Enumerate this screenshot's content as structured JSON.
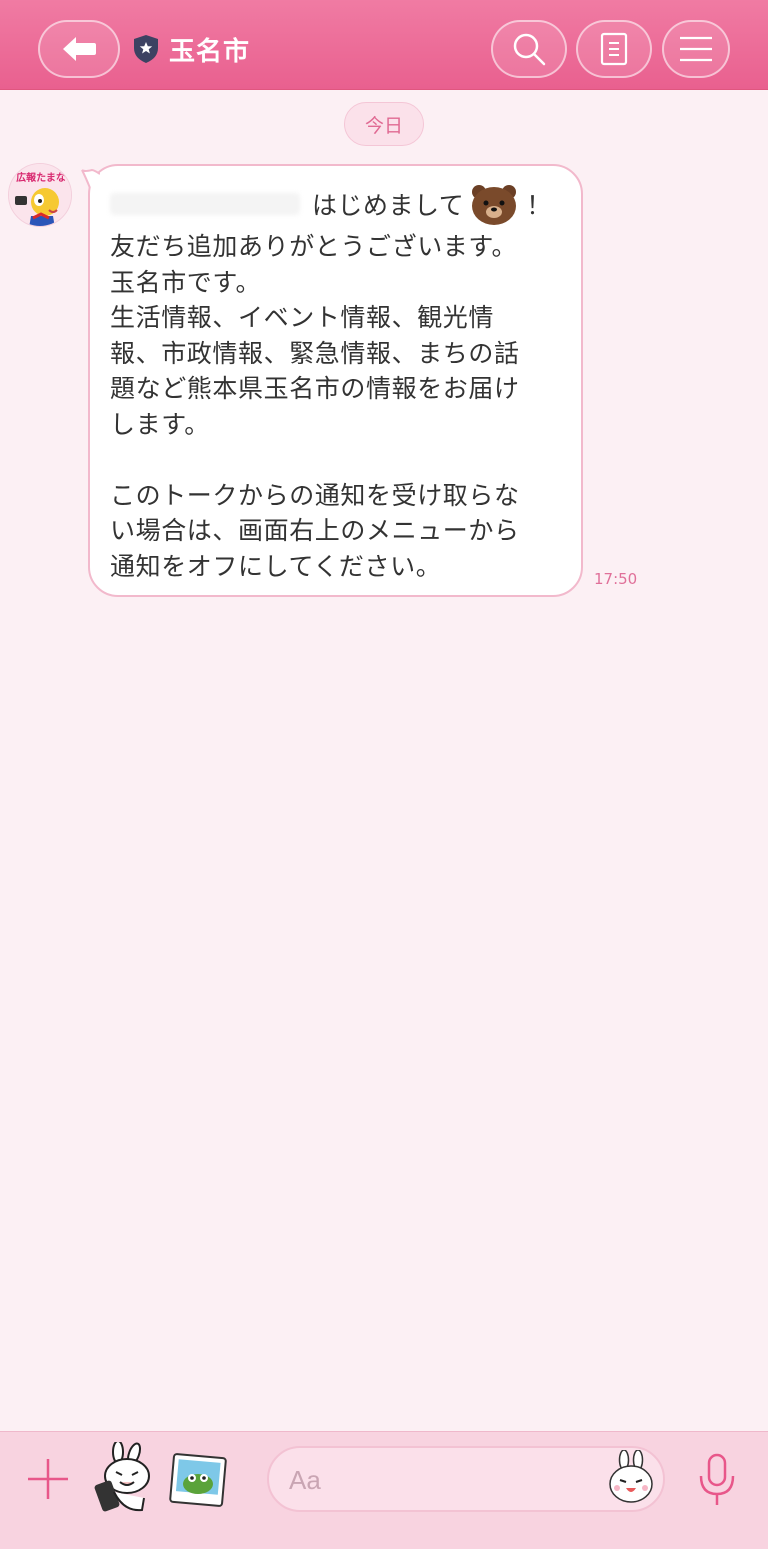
{
  "header": {
    "title": "玉名市",
    "back_icon": "back-arrow-icon",
    "badge_icon": "official-account-shield-icon",
    "search_icon": "search-icon",
    "notes_icon": "notes-icon",
    "menu_icon": "hamburger-menu-icon"
  },
  "chat": {
    "date_label": "今日",
    "avatar_label": "広報たまな",
    "message": {
      "greeting": "はじめまして",
      "greeting_end": "！",
      "body": "友だち追加ありがとうございます。\n玉名市です。\n生活情報、イベント情報、観光情\n報、市政情報、緊急情報、まちの話\n題など熊本県玉名市の情報をお届け\nします。\n\nこのトークからの通知を受け取らな\nい場合は、画面右上のメニューから\n通知をオフにしてください。",
      "time": "17:50"
    }
  },
  "composer": {
    "placeholder": "Aa",
    "plus_icon": "plus-icon",
    "sticker_icon": "sticker-icon",
    "photo_icon": "photo-icon",
    "emoji_icon": "emoji-icon",
    "mic_icon": "microphone-icon"
  },
  "colors": {
    "header": "#ea6493",
    "background": "#fcf0f4",
    "bubble_border": "#f2b9cc",
    "accent": "#e06a93"
  }
}
